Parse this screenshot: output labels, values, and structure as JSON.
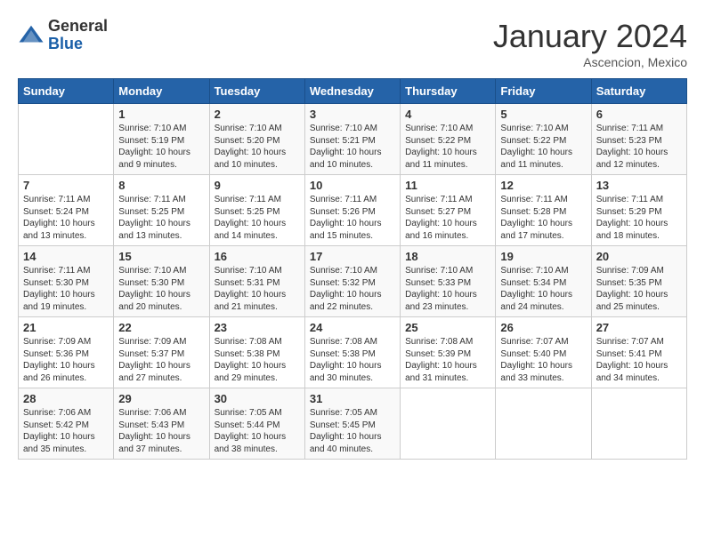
{
  "logo": {
    "general": "General",
    "blue": "Blue"
  },
  "header": {
    "month": "January 2024",
    "location": "Ascencion, Mexico"
  },
  "days_of_week": [
    "Sunday",
    "Monday",
    "Tuesday",
    "Wednesday",
    "Thursday",
    "Friday",
    "Saturday"
  ],
  "weeks": [
    [
      {
        "day": "",
        "sunrise": "",
        "sunset": "",
        "daylight": ""
      },
      {
        "day": "1",
        "sunrise": "Sunrise: 7:10 AM",
        "sunset": "Sunset: 5:19 PM",
        "daylight": "Daylight: 10 hours and 9 minutes."
      },
      {
        "day": "2",
        "sunrise": "Sunrise: 7:10 AM",
        "sunset": "Sunset: 5:20 PM",
        "daylight": "Daylight: 10 hours and 10 minutes."
      },
      {
        "day": "3",
        "sunrise": "Sunrise: 7:10 AM",
        "sunset": "Sunset: 5:21 PM",
        "daylight": "Daylight: 10 hours and 10 minutes."
      },
      {
        "day": "4",
        "sunrise": "Sunrise: 7:10 AM",
        "sunset": "Sunset: 5:22 PM",
        "daylight": "Daylight: 10 hours and 11 minutes."
      },
      {
        "day": "5",
        "sunrise": "Sunrise: 7:10 AM",
        "sunset": "Sunset: 5:22 PM",
        "daylight": "Daylight: 10 hours and 11 minutes."
      },
      {
        "day": "6",
        "sunrise": "Sunrise: 7:11 AM",
        "sunset": "Sunset: 5:23 PM",
        "daylight": "Daylight: 10 hours and 12 minutes."
      }
    ],
    [
      {
        "day": "7",
        "sunrise": "Sunrise: 7:11 AM",
        "sunset": "Sunset: 5:24 PM",
        "daylight": "Daylight: 10 hours and 13 minutes."
      },
      {
        "day": "8",
        "sunrise": "Sunrise: 7:11 AM",
        "sunset": "Sunset: 5:25 PM",
        "daylight": "Daylight: 10 hours and 13 minutes."
      },
      {
        "day": "9",
        "sunrise": "Sunrise: 7:11 AM",
        "sunset": "Sunset: 5:25 PM",
        "daylight": "Daylight: 10 hours and 14 minutes."
      },
      {
        "day": "10",
        "sunrise": "Sunrise: 7:11 AM",
        "sunset": "Sunset: 5:26 PM",
        "daylight": "Daylight: 10 hours and 15 minutes."
      },
      {
        "day": "11",
        "sunrise": "Sunrise: 7:11 AM",
        "sunset": "Sunset: 5:27 PM",
        "daylight": "Daylight: 10 hours and 16 minutes."
      },
      {
        "day": "12",
        "sunrise": "Sunrise: 7:11 AM",
        "sunset": "Sunset: 5:28 PM",
        "daylight": "Daylight: 10 hours and 17 minutes."
      },
      {
        "day": "13",
        "sunrise": "Sunrise: 7:11 AM",
        "sunset": "Sunset: 5:29 PM",
        "daylight": "Daylight: 10 hours and 18 minutes."
      }
    ],
    [
      {
        "day": "14",
        "sunrise": "Sunrise: 7:11 AM",
        "sunset": "Sunset: 5:30 PM",
        "daylight": "Daylight: 10 hours and 19 minutes."
      },
      {
        "day": "15",
        "sunrise": "Sunrise: 7:10 AM",
        "sunset": "Sunset: 5:30 PM",
        "daylight": "Daylight: 10 hours and 20 minutes."
      },
      {
        "day": "16",
        "sunrise": "Sunrise: 7:10 AM",
        "sunset": "Sunset: 5:31 PM",
        "daylight": "Daylight: 10 hours and 21 minutes."
      },
      {
        "day": "17",
        "sunrise": "Sunrise: 7:10 AM",
        "sunset": "Sunset: 5:32 PM",
        "daylight": "Daylight: 10 hours and 22 minutes."
      },
      {
        "day": "18",
        "sunrise": "Sunrise: 7:10 AM",
        "sunset": "Sunset: 5:33 PM",
        "daylight": "Daylight: 10 hours and 23 minutes."
      },
      {
        "day": "19",
        "sunrise": "Sunrise: 7:10 AM",
        "sunset": "Sunset: 5:34 PM",
        "daylight": "Daylight: 10 hours and 24 minutes."
      },
      {
        "day": "20",
        "sunrise": "Sunrise: 7:09 AM",
        "sunset": "Sunset: 5:35 PM",
        "daylight": "Daylight: 10 hours and 25 minutes."
      }
    ],
    [
      {
        "day": "21",
        "sunrise": "Sunrise: 7:09 AM",
        "sunset": "Sunset: 5:36 PM",
        "daylight": "Daylight: 10 hours and 26 minutes."
      },
      {
        "day": "22",
        "sunrise": "Sunrise: 7:09 AM",
        "sunset": "Sunset: 5:37 PM",
        "daylight": "Daylight: 10 hours and 27 minutes."
      },
      {
        "day": "23",
        "sunrise": "Sunrise: 7:08 AM",
        "sunset": "Sunset: 5:38 PM",
        "daylight": "Daylight: 10 hours and 29 minutes."
      },
      {
        "day": "24",
        "sunrise": "Sunrise: 7:08 AM",
        "sunset": "Sunset: 5:38 PM",
        "daylight": "Daylight: 10 hours and 30 minutes."
      },
      {
        "day": "25",
        "sunrise": "Sunrise: 7:08 AM",
        "sunset": "Sunset: 5:39 PM",
        "daylight": "Daylight: 10 hours and 31 minutes."
      },
      {
        "day": "26",
        "sunrise": "Sunrise: 7:07 AM",
        "sunset": "Sunset: 5:40 PM",
        "daylight": "Daylight: 10 hours and 33 minutes."
      },
      {
        "day": "27",
        "sunrise": "Sunrise: 7:07 AM",
        "sunset": "Sunset: 5:41 PM",
        "daylight": "Daylight: 10 hours and 34 minutes."
      }
    ],
    [
      {
        "day": "28",
        "sunrise": "Sunrise: 7:06 AM",
        "sunset": "Sunset: 5:42 PM",
        "daylight": "Daylight: 10 hours and 35 minutes."
      },
      {
        "day": "29",
        "sunrise": "Sunrise: 7:06 AM",
        "sunset": "Sunset: 5:43 PM",
        "daylight": "Daylight: 10 hours and 37 minutes."
      },
      {
        "day": "30",
        "sunrise": "Sunrise: 7:05 AM",
        "sunset": "Sunset: 5:44 PM",
        "daylight": "Daylight: 10 hours and 38 minutes."
      },
      {
        "day": "31",
        "sunrise": "Sunrise: 7:05 AM",
        "sunset": "Sunset: 5:45 PM",
        "daylight": "Daylight: 10 hours and 40 minutes."
      },
      {
        "day": "",
        "sunrise": "",
        "sunset": "",
        "daylight": ""
      },
      {
        "day": "",
        "sunrise": "",
        "sunset": "",
        "daylight": ""
      },
      {
        "day": "",
        "sunrise": "",
        "sunset": "",
        "daylight": ""
      }
    ]
  ]
}
